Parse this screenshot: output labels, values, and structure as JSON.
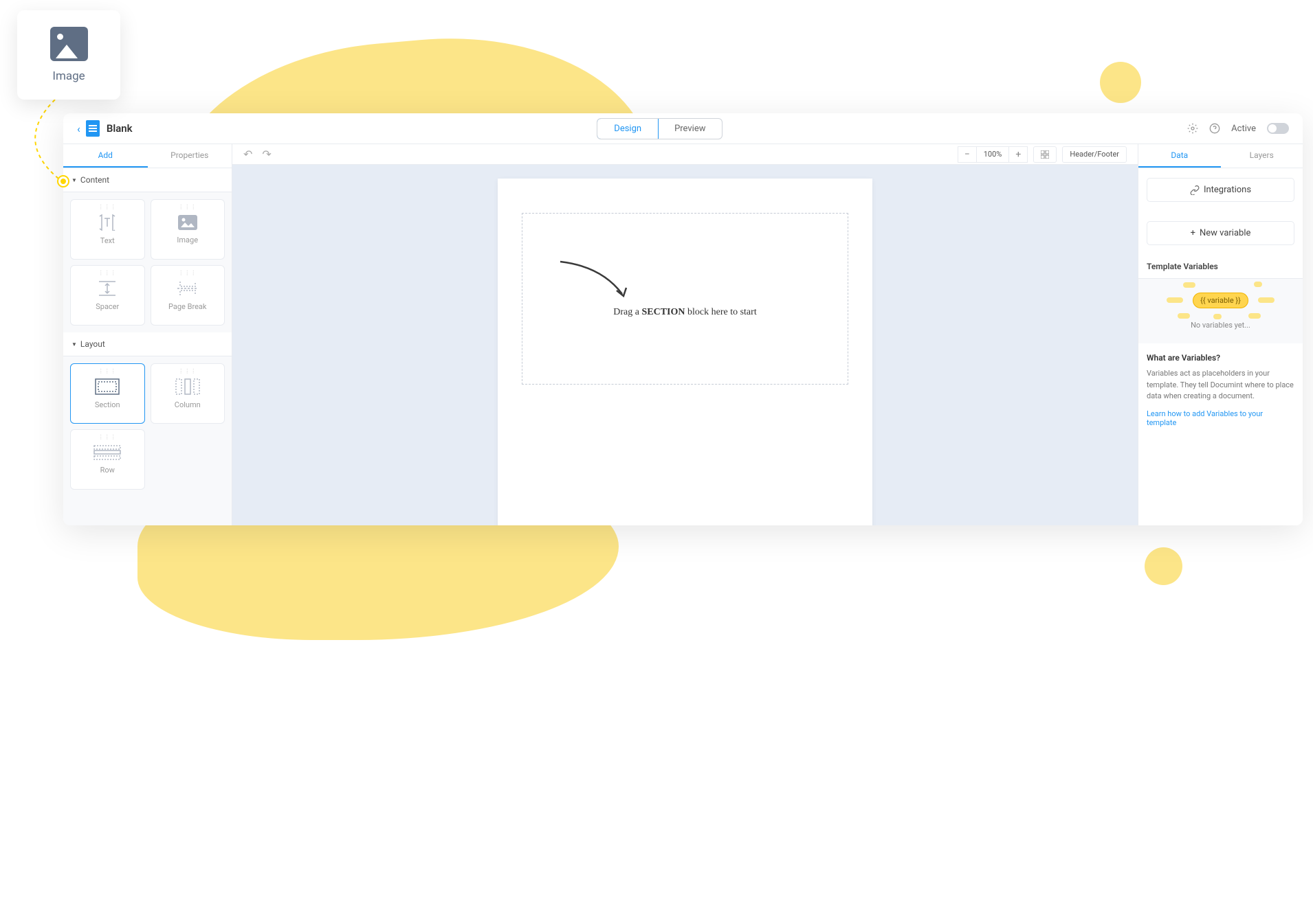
{
  "floating_card": {
    "label": "Image"
  },
  "header": {
    "title": "Blank",
    "tabs": {
      "design": "Design",
      "preview": "Preview"
    },
    "active_label": "Active"
  },
  "left_sidebar": {
    "tabs": {
      "add": "Add",
      "properties": "Properties"
    },
    "content_section": "Content",
    "layout_section": "Layout",
    "blocks": {
      "text": "Text",
      "image": "Image",
      "spacer": "Spacer",
      "page_break": "Page Break",
      "section": "Section",
      "column": "Column",
      "row": "Row"
    }
  },
  "toolbar": {
    "zoom": "100%",
    "header_footer": "Header/Footer"
  },
  "canvas": {
    "drop_prefix": "Drag a ",
    "drop_bold": "SECTION",
    "drop_suffix": " block here to start"
  },
  "right_sidebar": {
    "tabs": {
      "data": "Data",
      "layers": "Layers"
    },
    "integrations_btn": "Integrations",
    "new_variable_btn": "New variable",
    "template_vars_title": "Template Variables",
    "variable_badge": "{{ variable }}",
    "empty_text": "No variables yet...",
    "info_title": "What are Variables?",
    "info_text": "Variables act as placeholders in your template. They tell Documint where to place data when creating a document.",
    "info_link": "Learn how to add Variables to your template"
  }
}
